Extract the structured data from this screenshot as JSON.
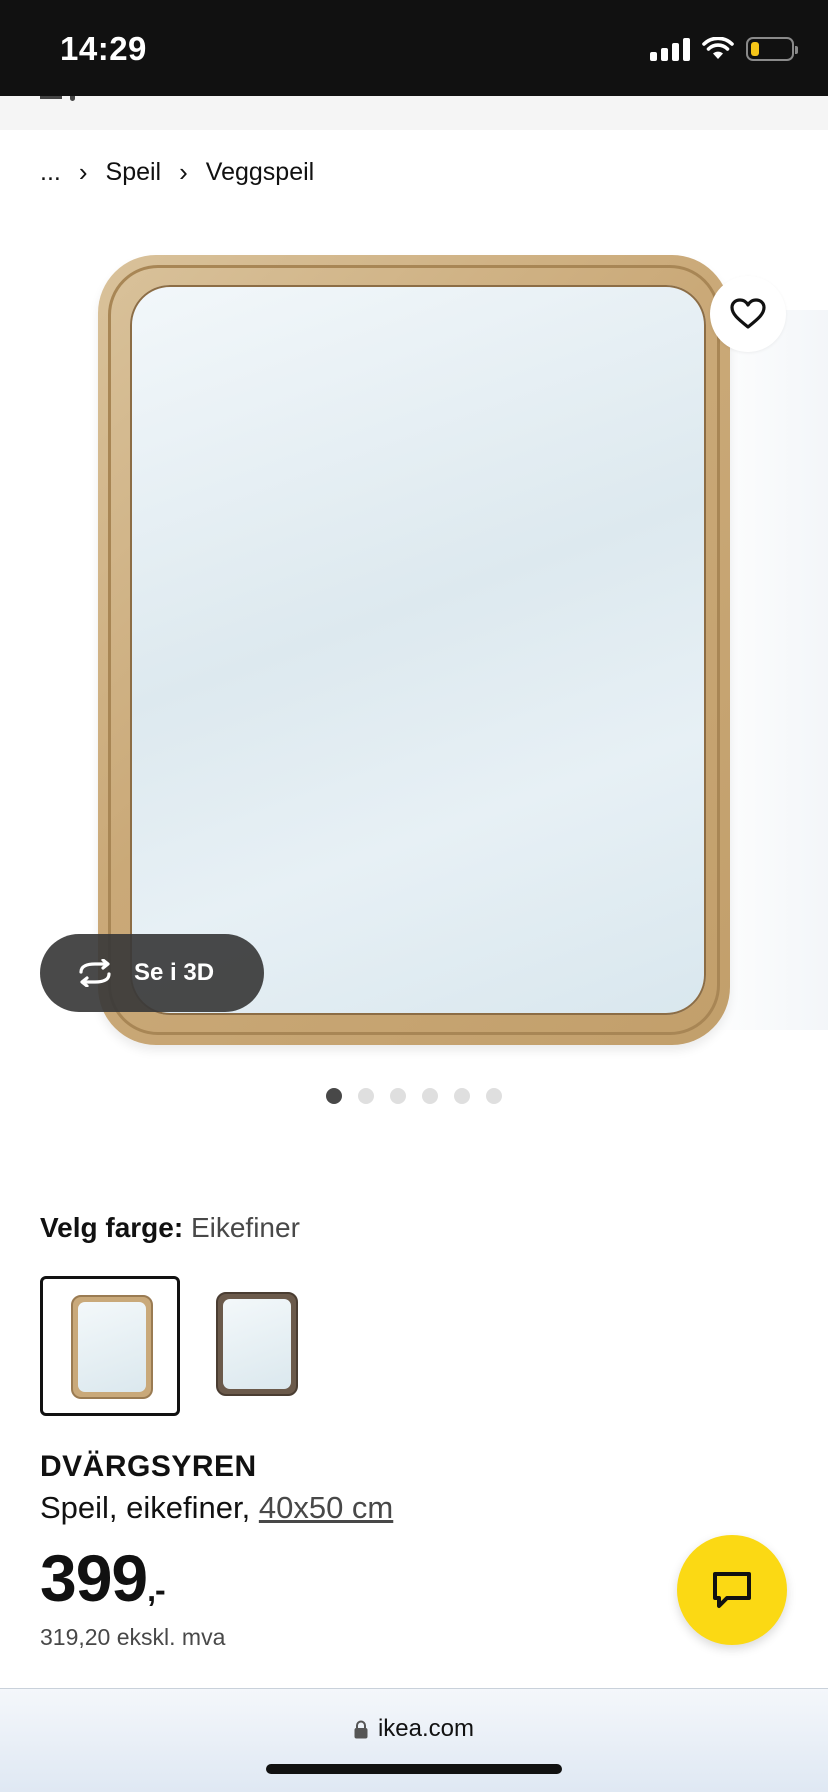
{
  "status_bar": {
    "time": "14:29",
    "battery_level": 0.2,
    "icons": [
      "signal-icon",
      "wifi-icon",
      "battery-icon"
    ]
  },
  "breadcrumb": {
    "ellipsis": "...",
    "items": [
      "Speil",
      "Veggspeil"
    ],
    "separator_icon": "chevron-right-icon"
  },
  "gallery": {
    "favorite_icon": "heart-icon",
    "view_3d_label": "Se i 3D",
    "view_3d_icon": "rotate-3d-icon",
    "page_count": 6,
    "active_page": 1
  },
  "color_selector": {
    "label": "Velg farge:",
    "selected_value": "Eikefiner",
    "options": [
      {
        "name": "oak-veneer-swatch",
        "selected": true,
        "frame_color": "#c9a97a"
      },
      {
        "name": "dark-brown-swatch",
        "selected": false,
        "frame_color": "#6b5a4b"
      }
    ]
  },
  "product": {
    "name": "DVÄRGSYREN",
    "description": "Speil, eikefiner,",
    "size_link": "40x50 cm",
    "price": "399",
    "price_suffix": ",-",
    "price_ex_vat": "319,20 ekskl. mva"
  },
  "chat": {
    "icon": "chat-bubble-icon"
  },
  "browser": {
    "url": "ikea.com",
    "lock_icon": "lock-icon"
  },
  "colors": {
    "brand_yellow": "#fbd914",
    "text_dark": "#111111",
    "text_muted": "#484848"
  }
}
